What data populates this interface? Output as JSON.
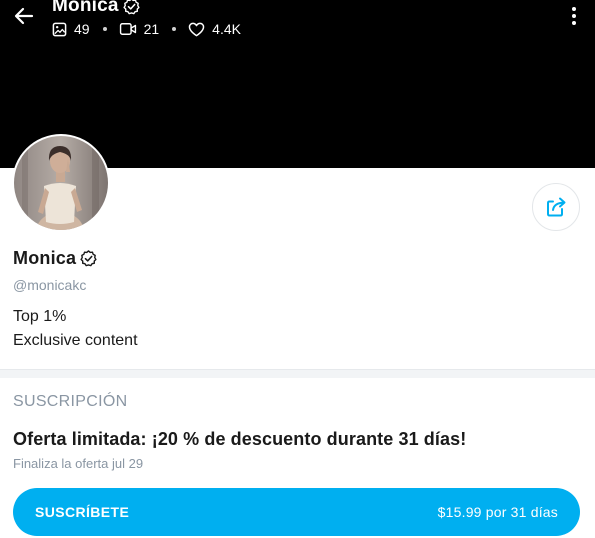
{
  "header": {
    "title": "Monica",
    "stats": [
      {
        "icon": "image-icon",
        "value": "49"
      },
      {
        "icon": "video-icon",
        "value": "21"
      },
      {
        "icon": "heart-icon",
        "value": "4.4K"
      }
    ]
  },
  "profile": {
    "name": "Monica",
    "handle": "@monicakc",
    "bio_line1": "Top 1%",
    "bio_line2": "Exclusive content",
    "verified": true
  },
  "subscription": {
    "heading": "SUSCRIPCIÓN",
    "offer": "Oferta limitada: ¡20 % de descuento durante 31 días!",
    "offer_end": "Finaliza la oferta jul 29",
    "button_label": "SUSCRÍBETE",
    "button_price": "$15.99 por 31 días"
  },
  "colors": {
    "accent": "#00aff0",
    "muted_text": "#8a96a3",
    "cover": "#000000"
  }
}
